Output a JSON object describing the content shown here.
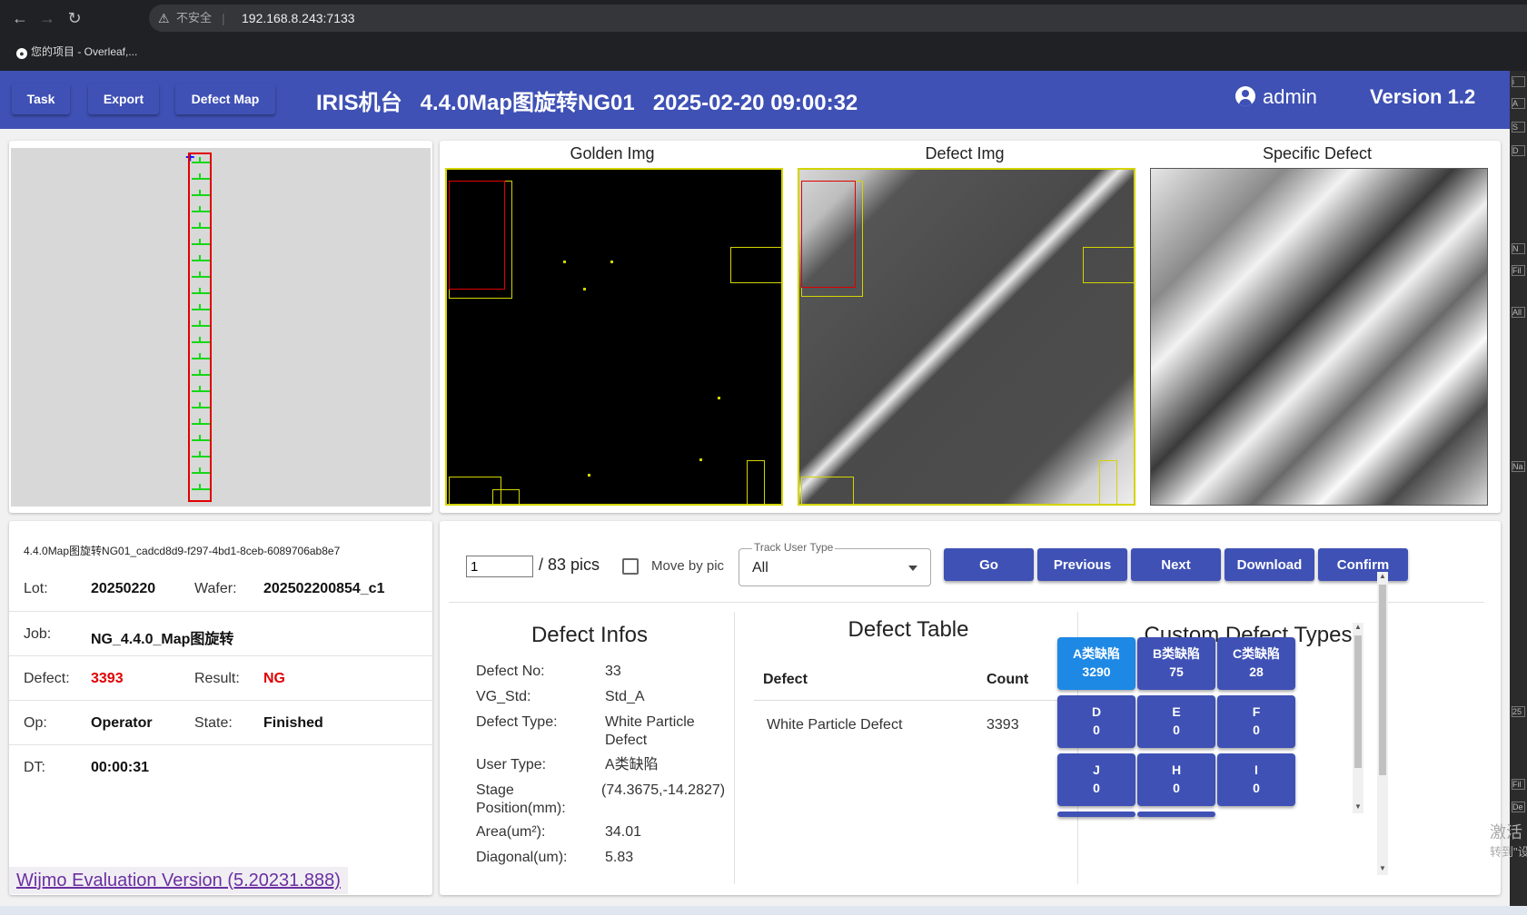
{
  "browser": {
    "insecure_label": "不安全",
    "separator": "|",
    "address": "192.168.8.243:7133",
    "bookmark": "您的项目 - Overleaf,..."
  },
  "appbar": {
    "task": "Task",
    "export": "Export",
    "defect_map": "Defect Map",
    "title": "IRIS机台   4.4.0Map图旋转NG01   2025-02-20 09:00:32",
    "user": "admin",
    "version": "Version 1.2"
  },
  "images": {
    "golden": "Golden Img",
    "defect": "Defect Img",
    "specific": "Specific Defect"
  },
  "info": {
    "filename": "4.4.0Map图旋转NG01_cadcd8d9-f297-4bd1-8ceb-6089706ab8e7",
    "lot_label": "Lot:",
    "lot": "20250220",
    "wafer_label": "Wafer:",
    "wafer": "202502200854_c1",
    "job_label": "Job:",
    "job": "NG_4.4.0_Map图旋转",
    "defect_label": "Defect:",
    "defect": "3393",
    "result_label": "Result:",
    "result": "NG",
    "op_label": "Op:",
    "op": "Operator",
    "state_label": "State:",
    "state": "Finished",
    "dt_label": "DT:",
    "dt": "00:00:31"
  },
  "wijmo": "Wijmo Evaluation Version (5.20231.888)",
  "controls": {
    "page": "1",
    "pics": "/ 83 pics",
    "move_by_pic": "Move by pic",
    "track_label": "Track User Type",
    "track_value": "All",
    "go": "Go",
    "previous": "Previous",
    "next": "Next",
    "download": "Download",
    "confirm": "Confirm"
  },
  "defect_infos": {
    "title": "Defect Infos",
    "rows": [
      {
        "label": "Defect No:",
        "value": "33"
      },
      {
        "label": "VG_Std:",
        "value": "Std_A"
      },
      {
        "label": "Defect Type:",
        "value": "White Particle Defect"
      },
      {
        "label": "User Type:",
        "value": "A类缺陷"
      },
      {
        "label": "Stage Position(mm):",
        "value": "(74.3675,-14.2827)"
      },
      {
        "label": "Area(um²):",
        "value": "34.01"
      },
      {
        "label": "Diagonal(um):",
        "value": "5.83"
      }
    ]
  },
  "defect_table": {
    "title": "Defect Table",
    "col_defect": "Defect",
    "col_count": "Count",
    "rows": [
      {
        "defect": "White Particle Defect",
        "count": "3393"
      }
    ]
  },
  "custom_types": {
    "title": "Custom Defect Types",
    "items": [
      {
        "name": "A类缺陷",
        "count": "3290"
      },
      {
        "name": "B类缺陷",
        "count": "75"
      },
      {
        "name": "C类缺陷",
        "count": "28"
      },
      {
        "name": "D",
        "count": "0"
      },
      {
        "name": "E",
        "count": "0"
      },
      {
        "name": "F",
        "count": "0"
      },
      {
        "name": "J",
        "count": "0"
      },
      {
        "name": "H",
        "count": "0"
      },
      {
        "name": "I",
        "count": "0"
      }
    ]
  },
  "watermark": {
    "line1": "激活 W",
    "line2": "转到\"设"
  },
  "devtools_marks": [
    "i",
    "A",
    "S",
    "D",
    "N",
    "Fil",
    "All",
    "Na",
    "25",
    "Fil",
    "De"
  ]
}
